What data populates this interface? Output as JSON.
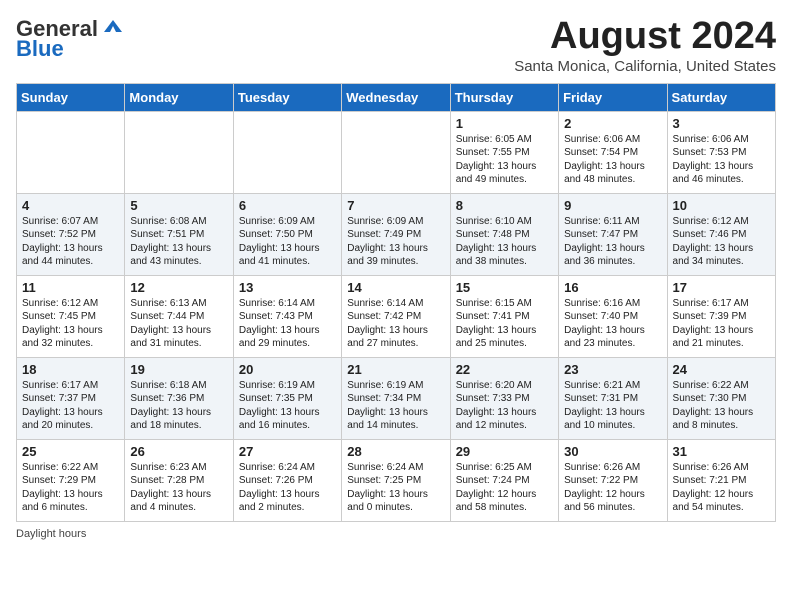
{
  "header": {
    "logo_general": "General",
    "logo_blue": "Blue",
    "month_title": "August 2024",
    "location": "Santa Monica, California, United States"
  },
  "days_of_week": [
    "Sunday",
    "Monday",
    "Tuesday",
    "Wednesday",
    "Thursday",
    "Friday",
    "Saturday"
  ],
  "footer": {
    "daylight_hours": "Daylight hours"
  },
  "weeks": [
    [
      {
        "day": "",
        "info": ""
      },
      {
        "day": "",
        "info": ""
      },
      {
        "day": "",
        "info": ""
      },
      {
        "day": "",
        "info": ""
      },
      {
        "day": "1",
        "info": "Sunrise: 6:05 AM\nSunset: 7:55 PM\nDaylight: 13 hours and 49 minutes."
      },
      {
        "day": "2",
        "info": "Sunrise: 6:06 AM\nSunset: 7:54 PM\nDaylight: 13 hours and 48 minutes."
      },
      {
        "day": "3",
        "info": "Sunrise: 6:06 AM\nSunset: 7:53 PM\nDaylight: 13 hours and 46 minutes."
      }
    ],
    [
      {
        "day": "4",
        "info": "Sunrise: 6:07 AM\nSunset: 7:52 PM\nDaylight: 13 hours and 44 minutes."
      },
      {
        "day": "5",
        "info": "Sunrise: 6:08 AM\nSunset: 7:51 PM\nDaylight: 13 hours and 43 minutes."
      },
      {
        "day": "6",
        "info": "Sunrise: 6:09 AM\nSunset: 7:50 PM\nDaylight: 13 hours and 41 minutes."
      },
      {
        "day": "7",
        "info": "Sunrise: 6:09 AM\nSunset: 7:49 PM\nDaylight: 13 hours and 39 minutes."
      },
      {
        "day": "8",
        "info": "Sunrise: 6:10 AM\nSunset: 7:48 PM\nDaylight: 13 hours and 38 minutes."
      },
      {
        "day": "9",
        "info": "Sunrise: 6:11 AM\nSunset: 7:47 PM\nDaylight: 13 hours and 36 minutes."
      },
      {
        "day": "10",
        "info": "Sunrise: 6:12 AM\nSunset: 7:46 PM\nDaylight: 13 hours and 34 minutes."
      }
    ],
    [
      {
        "day": "11",
        "info": "Sunrise: 6:12 AM\nSunset: 7:45 PM\nDaylight: 13 hours and 32 minutes."
      },
      {
        "day": "12",
        "info": "Sunrise: 6:13 AM\nSunset: 7:44 PM\nDaylight: 13 hours and 31 minutes."
      },
      {
        "day": "13",
        "info": "Sunrise: 6:14 AM\nSunset: 7:43 PM\nDaylight: 13 hours and 29 minutes."
      },
      {
        "day": "14",
        "info": "Sunrise: 6:14 AM\nSunset: 7:42 PM\nDaylight: 13 hours and 27 minutes."
      },
      {
        "day": "15",
        "info": "Sunrise: 6:15 AM\nSunset: 7:41 PM\nDaylight: 13 hours and 25 minutes."
      },
      {
        "day": "16",
        "info": "Sunrise: 6:16 AM\nSunset: 7:40 PM\nDaylight: 13 hours and 23 minutes."
      },
      {
        "day": "17",
        "info": "Sunrise: 6:17 AM\nSunset: 7:39 PM\nDaylight: 13 hours and 21 minutes."
      }
    ],
    [
      {
        "day": "18",
        "info": "Sunrise: 6:17 AM\nSunset: 7:37 PM\nDaylight: 13 hours and 20 minutes."
      },
      {
        "day": "19",
        "info": "Sunrise: 6:18 AM\nSunset: 7:36 PM\nDaylight: 13 hours and 18 minutes."
      },
      {
        "day": "20",
        "info": "Sunrise: 6:19 AM\nSunset: 7:35 PM\nDaylight: 13 hours and 16 minutes."
      },
      {
        "day": "21",
        "info": "Sunrise: 6:19 AM\nSunset: 7:34 PM\nDaylight: 13 hours and 14 minutes."
      },
      {
        "day": "22",
        "info": "Sunrise: 6:20 AM\nSunset: 7:33 PM\nDaylight: 13 hours and 12 minutes."
      },
      {
        "day": "23",
        "info": "Sunrise: 6:21 AM\nSunset: 7:31 PM\nDaylight: 13 hours and 10 minutes."
      },
      {
        "day": "24",
        "info": "Sunrise: 6:22 AM\nSunset: 7:30 PM\nDaylight: 13 hours and 8 minutes."
      }
    ],
    [
      {
        "day": "25",
        "info": "Sunrise: 6:22 AM\nSunset: 7:29 PM\nDaylight: 13 hours and 6 minutes."
      },
      {
        "day": "26",
        "info": "Sunrise: 6:23 AM\nSunset: 7:28 PM\nDaylight: 13 hours and 4 minutes."
      },
      {
        "day": "27",
        "info": "Sunrise: 6:24 AM\nSunset: 7:26 PM\nDaylight: 13 hours and 2 minutes."
      },
      {
        "day": "28",
        "info": "Sunrise: 6:24 AM\nSunset: 7:25 PM\nDaylight: 13 hours and 0 minutes."
      },
      {
        "day": "29",
        "info": "Sunrise: 6:25 AM\nSunset: 7:24 PM\nDaylight: 12 hours and 58 minutes."
      },
      {
        "day": "30",
        "info": "Sunrise: 6:26 AM\nSunset: 7:22 PM\nDaylight: 12 hours and 56 minutes."
      },
      {
        "day": "31",
        "info": "Sunrise: 6:26 AM\nSunset: 7:21 PM\nDaylight: 12 hours and 54 minutes."
      }
    ]
  ]
}
